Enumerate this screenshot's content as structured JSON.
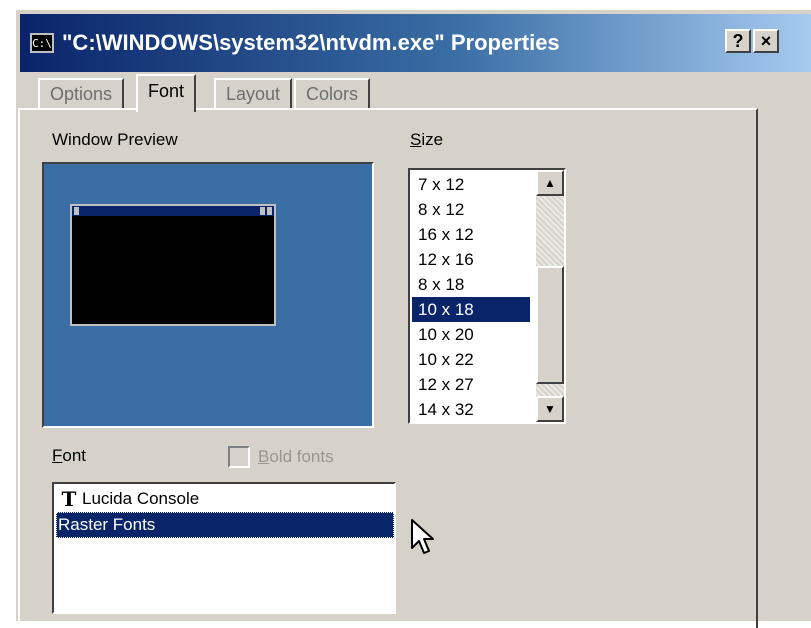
{
  "window": {
    "icon_text": "C:\\",
    "title": "\"C:\\WINDOWS\\system32\\ntvdm.exe\" Properties",
    "help_glyph": "?",
    "close_glyph": "×"
  },
  "tabs": [
    {
      "label": "Options",
      "active": false
    },
    {
      "label": "Font",
      "active": true
    },
    {
      "label": "Layout",
      "active": false
    },
    {
      "label": "Colors",
      "active": false
    }
  ],
  "preview": {
    "label": "Window Preview"
  },
  "size": {
    "label_first": "S",
    "label_rest": "ize",
    "items": [
      "7 x 12",
      "8 x 12",
      "16 x 12",
      "12 x 16",
      "8 x 18",
      "10 x 18",
      "10 x 20",
      "10 x 22",
      "12 x 27",
      "14 x 32"
    ],
    "selected": "10 x 18",
    "scroll_up_glyph": "▲",
    "scroll_down_glyph": "▼"
  },
  "font": {
    "label_first": "F",
    "label_rest": "ont",
    "bold_label_first": "B",
    "bold_label_rest": "old fonts",
    "bold_checked": false,
    "items": [
      {
        "name": "Lucida Console",
        "icon": "truetype-icon"
      },
      {
        "name": "Raster Fonts",
        "icon": ""
      }
    ],
    "selected": "Raster Fonts",
    "tt_glyph": "T"
  },
  "colors": {
    "title_active": "#0a246a",
    "preview_bg": "#3a6ea5",
    "dialog_bg": "#d6d2ca",
    "selection": "#0a246a"
  }
}
